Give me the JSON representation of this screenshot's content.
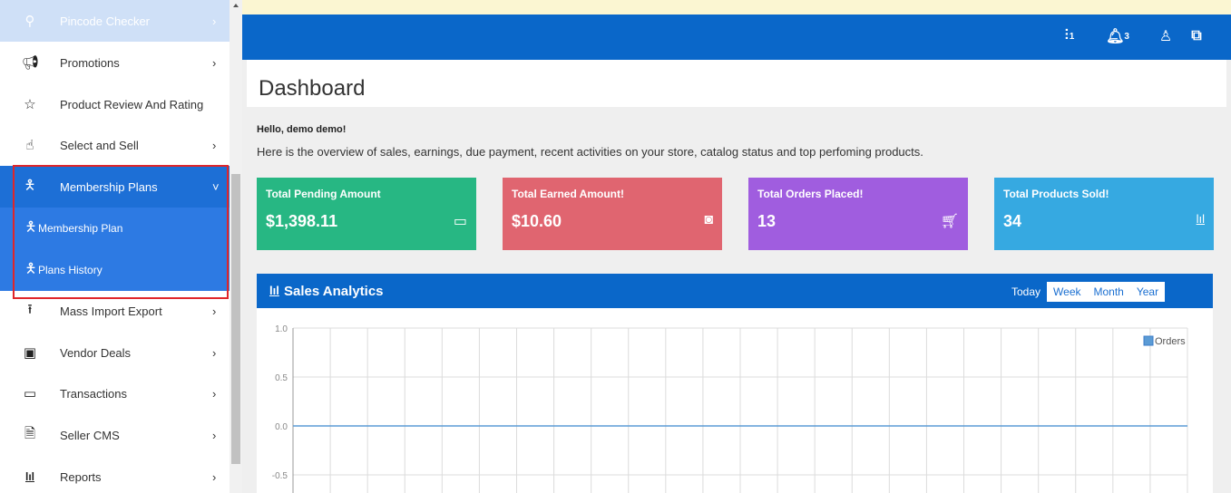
{
  "sidebar": {
    "items": [
      {
        "label": "Pincode Checker",
        "icon": "map-marker-icon",
        "chevron": "›"
      },
      {
        "label": "Promotions",
        "icon": "megaphone-icon",
        "chevron": "›"
      },
      {
        "label": "Product Review And Rating",
        "icon": "star-icon",
        "chevron": ""
      },
      {
        "label": "Select and Sell",
        "icon": "hand-pointer-icon",
        "chevron": "›"
      },
      {
        "label": "Membership Plans",
        "icon": "person-icon",
        "chevron": "˅"
      },
      {
        "label": "Membership Plan",
        "icon": "person-icon"
      },
      {
        "label": "Plans History",
        "icon": "person-icon"
      },
      {
        "label": "Mass Import Export",
        "icon": "upload-icon",
        "chevron": "›"
      },
      {
        "label": "Vendor Deals",
        "icon": "gift-icon",
        "chevron": "›"
      },
      {
        "label": "Transactions",
        "icon": "money-icon",
        "chevron": "›"
      },
      {
        "label": "Seller CMS",
        "icon": "document-icon",
        "chevron": "›"
      },
      {
        "label": "Reports",
        "icon": "bar-chart-icon",
        "chevron": "›"
      }
    ]
  },
  "header": {
    "icons": [
      "settings-sliders-icon",
      "bell-icon",
      "user-icon",
      "external-link-icon"
    ],
    "badges": [
      "1",
      "3"
    ]
  },
  "page": {
    "title": "Dashboard",
    "greeting": "Hello, demo demo!",
    "overview": "Here is the overview of sales, earnings, due payment, recent activities on your store, catalog status and top perfoming products."
  },
  "cards": [
    {
      "title": "Total Pending Amount",
      "value": "$1,398.11",
      "icon": "credit-card-icon",
      "color": "#27b783"
    },
    {
      "title": "Total Earned Amount!",
      "value": "$10.60",
      "icon": "money-icon",
      "color": "#e06570"
    },
    {
      "title": "Total Orders Placed!",
      "value": "13",
      "icon": "cart-icon",
      "color": "#a05ddf"
    },
    {
      "title": "Total Products Sold!",
      "value": "34",
      "icon": "bar-chart-icon",
      "color": "#36a9e1"
    }
  ],
  "analytics": {
    "title": "Sales Analytics",
    "tabs": [
      "Today",
      "Week",
      "Month",
      "Year"
    ],
    "active_tab": "Today"
  },
  "chart_data": {
    "type": "line",
    "title": "",
    "series": [
      {
        "name": "Orders",
        "values": [
          0,
          0
        ]
      }
    ],
    "y_ticks": [
      "1.0",
      "0.5",
      "0.0",
      "-0.5"
    ],
    "ylim": [
      -1.0,
      1.0
    ],
    "grid": true,
    "legend": "top-right",
    "color": "#5b9bd5"
  },
  "colors": {
    "sidebar_active": "#1d6fd6",
    "topbar": "#0a67c9",
    "highlight_border": "#e0262a"
  }
}
